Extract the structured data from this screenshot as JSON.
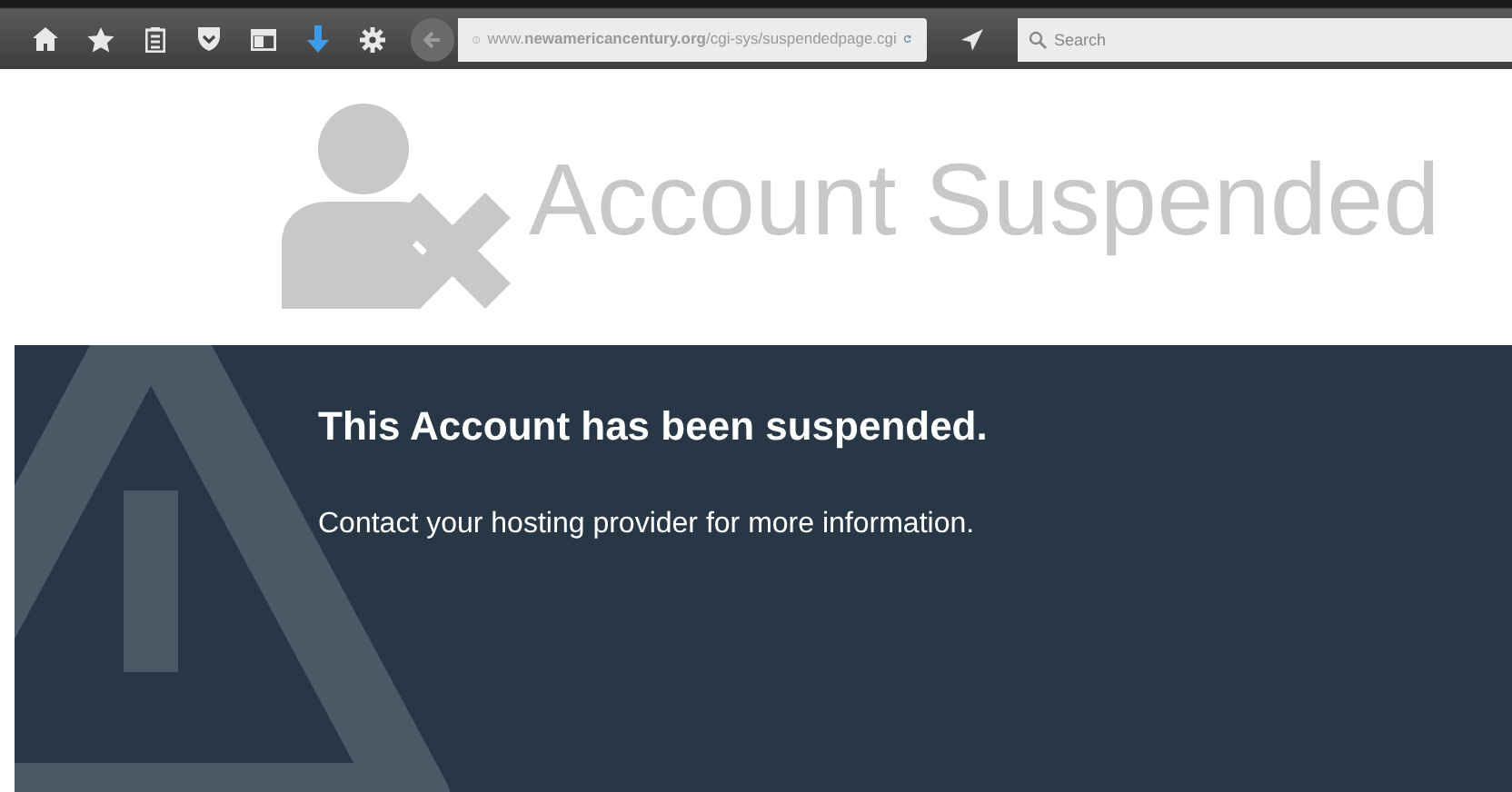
{
  "toolbar": {
    "url": "www.**newamericancentury.org**/cgi-sys/suspendedpage.cgi",
    "search": {
      "placeholder": "Search"
    }
  },
  "header": {
    "title": "Account Suspended"
  },
  "panel": {
    "heading": "This Account has been suspended.",
    "message": "Contact your hosting provider for more information."
  }
}
